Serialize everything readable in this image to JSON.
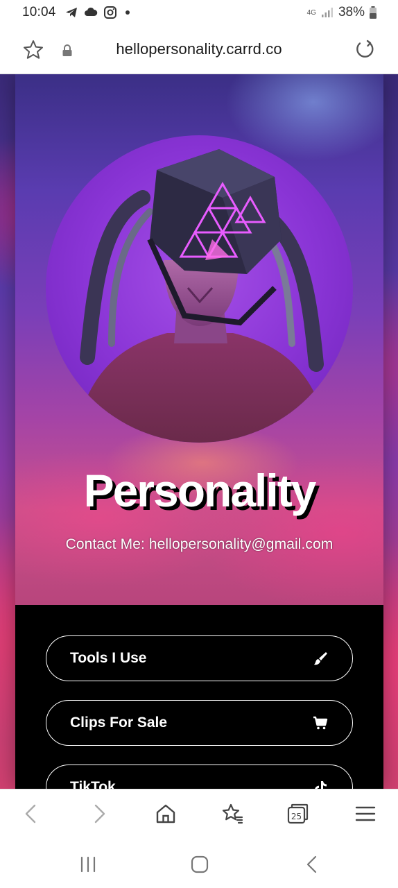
{
  "status_bar": {
    "time": "10:04",
    "network": "4G",
    "battery": "38%",
    "icons": [
      "telegram-icon",
      "cloud-icon",
      "instagram-icon",
      "signal-icon",
      "battery-icon"
    ]
  },
  "browser": {
    "url": "hellopersonality.carrd.co",
    "icons": [
      "favorite-star-icon",
      "lock-icon",
      "reload-icon"
    ],
    "tab_count": "25"
  },
  "page": {
    "title": "Personality",
    "contact": "Contact Me: hellopersonality@gmail.com",
    "links": [
      {
        "label": "Tools I Use",
        "icon": "paintbrush-icon"
      },
      {
        "label": "Clips For Sale",
        "icon": "cart-icon"
      },
      {
        "label": "TikTok",
        "icon": "tiktok-icon"
      }
    ]
  },
  "colors": {
    "link_bg": "#000000",
    "link_border": "#ffffff",
    "avatar_accent": "#8a35d6"
  }
}
